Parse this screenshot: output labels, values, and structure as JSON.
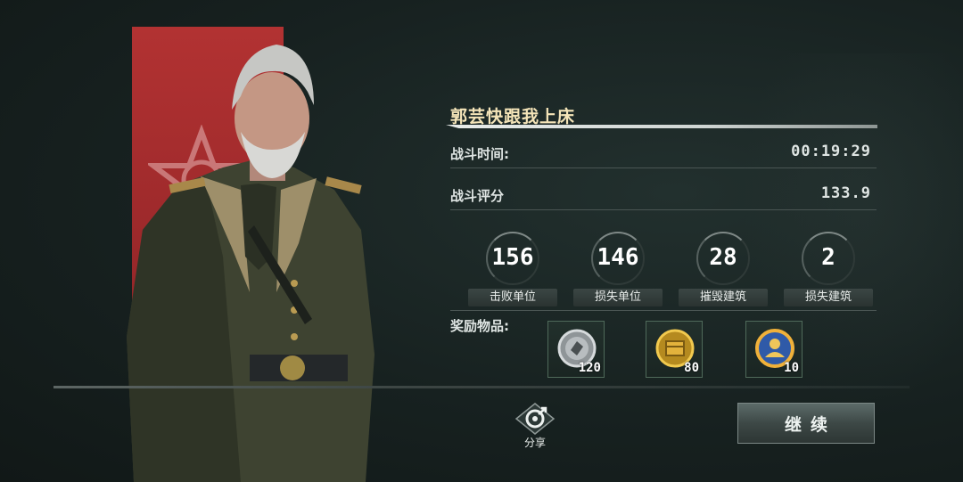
{
  "player": {
    "name": "郭芸快跟我上床"
  },
  "battle": {
    "time_label": "战斗时间:",
    "time_value": "00:19:29",
    "score_label": "战斗评分",
    "score_value": "133.9"
  },
  "counters": [
    {
      "value": "156",
      "label": "击败单位"
    },
    {
      "value": "146",
      "label": "损失单位"
    },
    {
      "value": "28",
      "label": "摧毁建筑"
    },
    {
      "value": "2",
      "label": "损失建筑"
    }
  ],
  "rewards": {
    "label": "奖励物品:",
    "items": [
      {
        "icon": "silver-coin-icon",
        "count": "120"
      },
      {
        "icon": "gold-crate-icon",
        "count": "80"
      },
      {
        "icon": "officer-medal-icon",
        "count": "10"
      }
    ]
  },
  "share": {
    "label": "分享"
  },
  "continue": {
    "label": "继续"
  },
  "colors": {
    "banner_red": "#b23232",
    "name_gold": "#f4e4b8",
    "background": "#1a2322"
  }
}
